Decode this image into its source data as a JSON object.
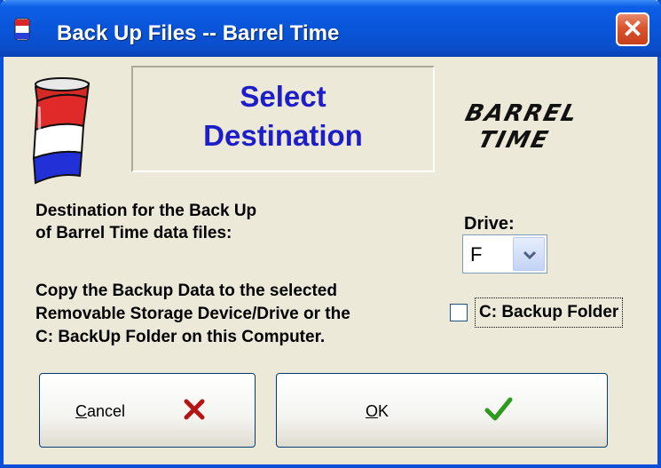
{
  "window": {
    "title": "Back Up Files -- Barrel Time",
    "close_icon": "close-icon"
  },
  "header": {
    "line1": "Select",
    "line2": "Destination",
    "logo_line1": "BARREL",
    "logo_line2": "TIME"
  },
  "destination": {
    "line1": "Destination for the Back Up",
    "line2": "of Barrel Time data files:"
  },
  "instructions": {
    "line1": "Copy the Backup Data to the selected",
    "line2": "Removable Storage Device/Drive or the",
    "line3": "C: BackUp Folder on this Computer."
  },
  "drive": {
    "label": "Drive:",
    "value": "F"
  },
  "backup_folder": {
    "label": "C: Backup Folder",
    "checked": false
  },
  "buttons": {
    "cancel_mnemonic": "C",
    "cancel_rest": "ancel",
    "ok_mnemonic": "O",
    "ok_rest": "K"
  },
  "colors": {
    "title_bar": "#0a55d9",
    "accent_text": "#1e1ec8",
    "cancel_x": "#b41414",
    "ok_check": "#2e9a1e"
  }
}
